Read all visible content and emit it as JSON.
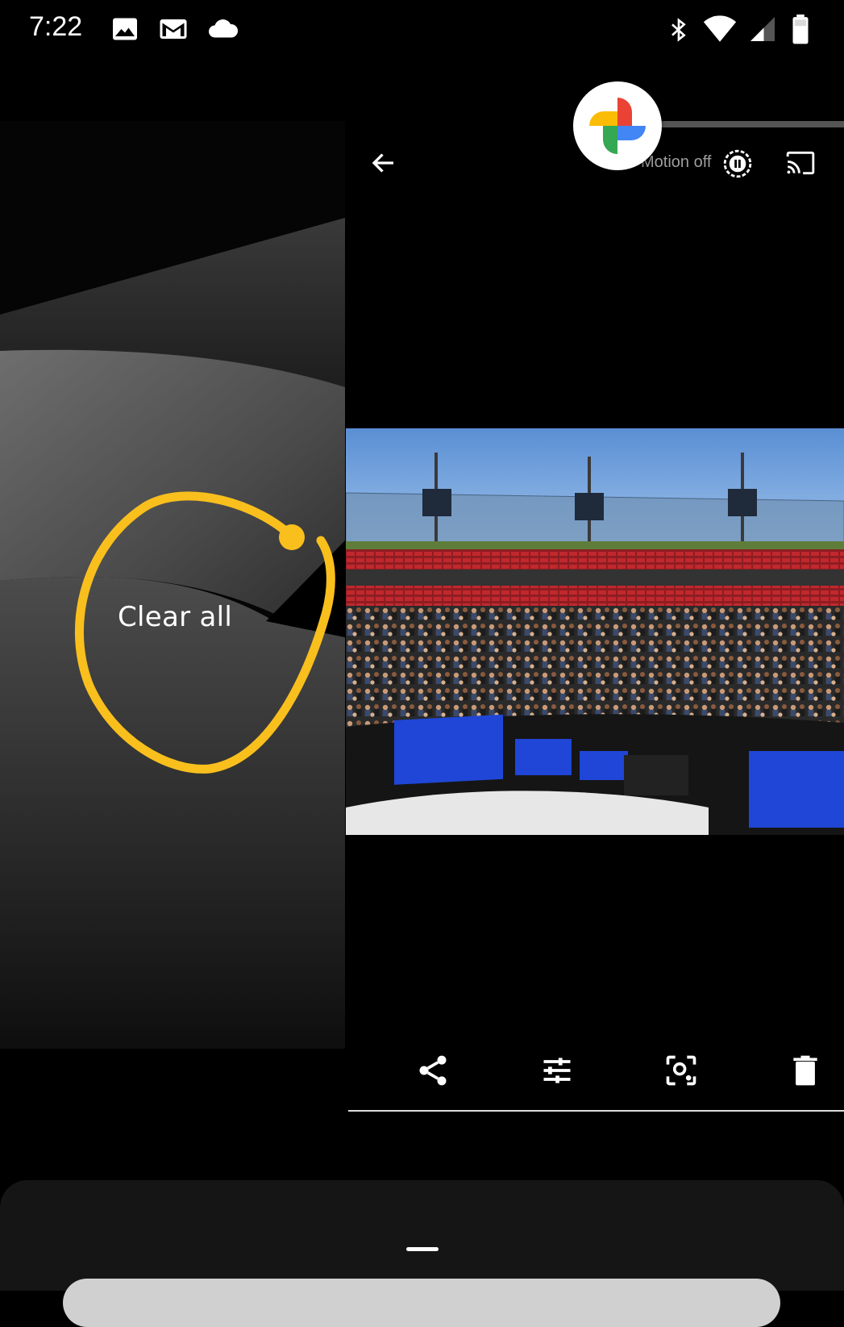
{
  "status_bar": {
    "time": "7:22",
    "left_icons": [
      "image-icon",
      "gmail-icon",
      "cloud-icon"
    ],
    "right_icons": [
      "bluetooth-icon",
      "wifi-icon",
      "signal-icon",
      "battery-icon"
    ]
  },
  "recents": {
    "clear_all_label": "Clear all",
    "highlight_color": "#f9bf1d"
  },
  "photos_app": {
    "motion_label": "Motion off",
    "toolbar_icons": [
      "back-arrow-icon",
      "motion-icon",
      "cast-icon"
    ],
    "bottom_actions": [
      "share-icon",
      "edit-icon",
      "lens-icon",
      "delete-icon"
    ]
  },
  "colors": {
    "background": "#000000",
    "highlight": "#f9bf1d",
    "sky": "#6a9cd8",
    "seats": "#c0282d",
    "screen_blue": "#1f46d6"
  }
}
